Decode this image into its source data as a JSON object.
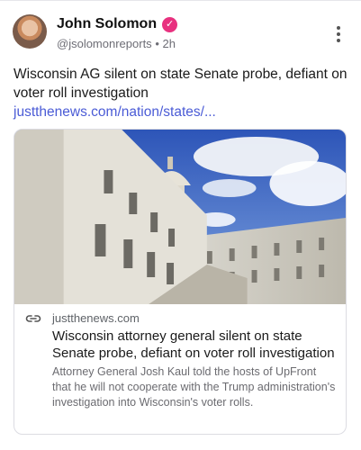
{
  "author": {
    "name": "John Solomon",
    "handle": "@jsolomonreports",
    "separator": "•",
    "time": "2h"
  },
  "post": {
    "text": "Wisconsin AG silent on state Senate probe, defiant on voter roll investigation ",
    "link_text": "justthenews.com/nation/states/..."
  },
  "card": {
    "domain": "justthenews.com",
    "title": "Wisconsin attorney general silent on state Senate probe, defiant on voter roll investigation",
    "description": "Attorney General Josh Kaul told the hosts of UpFront that he will not cooperate with the Trump administration's investigation into Wisconsin's voter rolls."
  },
  "icons": {
    "verified": "verified-badge-icon",
    "more": "more-vertical-icon",
    "link": "link-icon"
  },
  "colors": {
    "verified_badge": "#e8317f",
    "link": "#4a5bd6"
  }
}
